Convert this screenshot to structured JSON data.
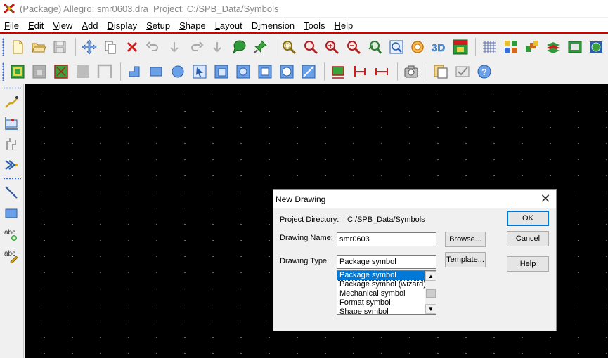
{
  "window": {
    "title": "(Package) Allegro: smr0603.dra  Project: C:/SPB_Data/Symbols"
  },
  "menu": [
    "File",
    "Edit",
    "View",
    "Add",
    "Display",
    "Setup",
    "Shape",
    "Layout",
    "Dimension",
    "Tools",
    "Help"
  ],
  "menu_underline": [
    "F",
    "E",
    "V",
    "A",
    "D",
    "S",
    "S",
    "L",
    "i",
    "T",
    "H"
  ],
  "dialog": {
    "title": "New Drawing",
    "project_directory_label": "Project Directory:",
    "project_directory_value": "C:/SPB_Data/Symbols",
    "drawing_name_label": "Drawing Name:",
    "drawing_name_value": "smr0603",
    "drawing_type_label": "Drawing Type:",
    "drawing_type_value": "Package symbol",
    "drawing_type_options": [
      "Package symbol",
      "Package symbol (wizard)",
      "Mechanical symbol",
      "Format symbol",
      "Shape symbol"
    ],
    "selected_option": "Package symbol",
    "browse_button": "Browse...",
    "template_button": "Template...",
    "ok_button": "OK",
    "cancel_button": "Cancel",
    "help_button": "Help",
    "close_glyph": "✕"
  },
  "toolbar_top": [
    "new-file-icon",
    "open-folder-icon",
    "save-icon",
    "move-icon",
    "copy-icon",
    "delete-icon",
    "undo-icon",
    "undo-arrow-icon",
    "redo-icon",
    "redo-arrow-icon",
    "assign-color-icon",
    "pin-icon",
    "zoom-points-icon",
    "zoom-fit-icon",
    "zoom-in-icon",
    "zoom-out-icon",
    "zoom-previous-icon",
    "zoom-world-icon",
    "redraw-icon",
    "3d-view-icon",
    "flip-view-icon",
    "grid-icon",
    "color-icon",
    "layers-icon",
    "shadow-icon",
    "xsection-icon",
    "world-view-icon"
  ],
  "toolbar_second": [
    "pin-add-icon",
    "locked-box-icon",
    "pad-icon",
    "grey-square-icon",
    "grey-bracket-icon",
    "step-line-icon",
    "rectangle-icon",
    "circle-icon",
    "select-arrow-icon",
    "nested-square-icon",
    "rounded-square-icon",
    "square-outline-icon",
    "circle-square-icon",
    "merge-shape-icon",
    "dimension-chip-icon",
    "dimension-red-icon",
    "dimension-horizontal-icon",
    "camera-icon",
    "report-icon",
    "checklist-icon",
    "help-icon"
  ],
  "toolbar_left": [
    "route-icon",
    "place-component-icon",
    "align-icon",
    "fanout-icon",
    "line-icon",
    "rectangle-icon",
    "add-text-icon",
    "edit-text-icon"
  ],
  "colors": {
    "canvas": "#000000",
    "selection": "#0078d7",
    "menu_rule": "#d00000"
  }
}
